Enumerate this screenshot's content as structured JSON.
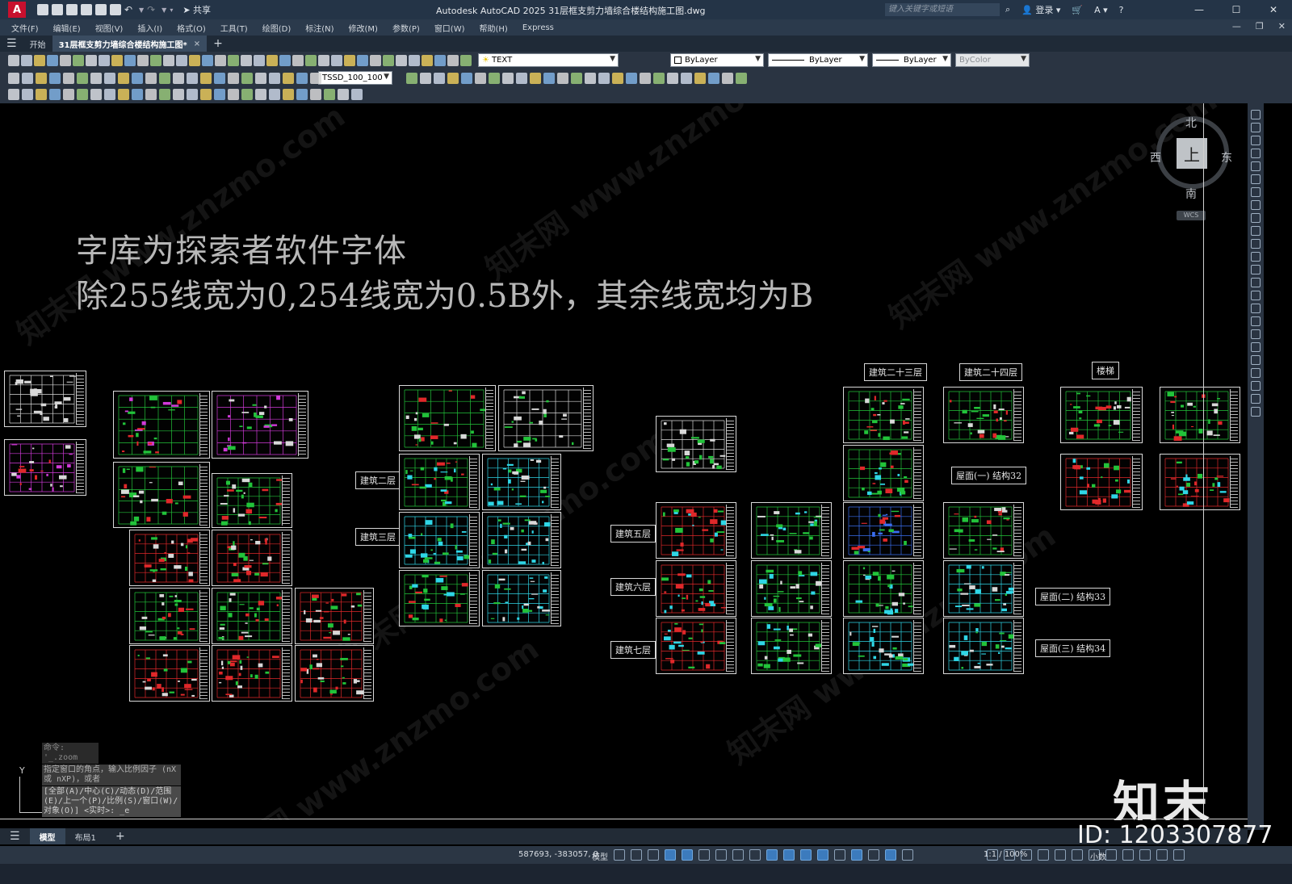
{
  "titlebar": {
    "app_logo": "A",
    "share_label": "共享",
    "title": "Autodesk AutoCAD 2025    31层框支剪力墙综合楼结构施工图.dwg",
    "search_placeholder": "键入关键字或短语",
    "login_label": "登录",
    "help_label": "?",
    "minimize": "—",
    "maximize": "☐",
    "close": "✕"
  },
  "menubar": {
    "items": [
      "文件(F)",
      "编辑(E)",
      "视图(V)",
      "插入(I)",
      "格式(O)",
      "工具(T)",
      "绘图(D)",
      "标注(N)",
      "修改(M)",
      "参数(P)",
      "窗口(W)",
      "帮助(H)",
      "Express"
    ]
  },
  "tabs": {
    "start_label": "开始",
    "drawing_label": "31层框支剪力墙综合楼结构施工图*",
    "close": "×",
    "new": "+"
  },
  "toolbar2": {
    "layer_combo": "TEXT",
    "color_combo": "ByLayer",
    "linetype_combo": "ByLayer",
    "lineweight_combo": "ByLayer",
    "plotstyle_combo": "ByColor"
  },
  "toolbar3": {
    "dimstyle_combo": "TSSD_100_100"
  },
  "canvas": {
    "note_line1": "字库为探索者软件字体",
    "note_line2": "除255线宽为0,254线宽为0.5B外，其余线宽均为B",
    "labels": {
      "floor2": "建筑二层",
      "floor3": "建筑三层",
      "floor5": "建筑五层",
      "floor6": "建筑六层",
      "floor7": "建筑七层",
      "floor23": "建筑二十三层",
      "floor24": "建筑二十四层",
      "stairs": "楼梯",
      "roof1": "屋面(一) 结构32",
      "roof2": "屋面(二) 结构33",
      "roof3": "屋面(三) 结构34"
    },
    "viewcube": {
      "north": "北",
      "south": "南",
      "east": "东",
      "west": "西",
      "face": "上",
      "wcs": "WCS"
    },
    "ucs_y": "Y",
    "command_history": [
      "命令: '_.zoom",
      "指定窗口的角点，输入比例因子 (nX 或 nXP)，或者",
      "[全部(A)/中心(C)/动态(D)/范围(E)/上一个(P)/比例(S)/窗口(W)/对象(O)] <实时>: _e"
    ]
  },
  "watermark": {
    "logo_text": "知末",
    "id_text": "ID: 1203307877",
    "site_text": "知末网 www.znzmo.com"
  },
  "layout_tabs": {
    "model_label": "模型",
    "layout1_label": "布局1",
    "add": "+"
  },
  "statusbar": {
    "coords": "587693, -383057, 0",
    "model_label": "模型",
    "scale_label": "1:1 / 100%",
    "units_label": "小数"
  },
  "colors": {
    "titlebar": "#243447",
    "canvas": "#000000",
    "accent": "#3c7bbd",
    "sheet_green": "#22c33a",
    "sheet_red": "#e0282a",
    "sheet_magenta": "#d13ad9",
    "sheet_cyan": "#2fd6e6"
  }
}
